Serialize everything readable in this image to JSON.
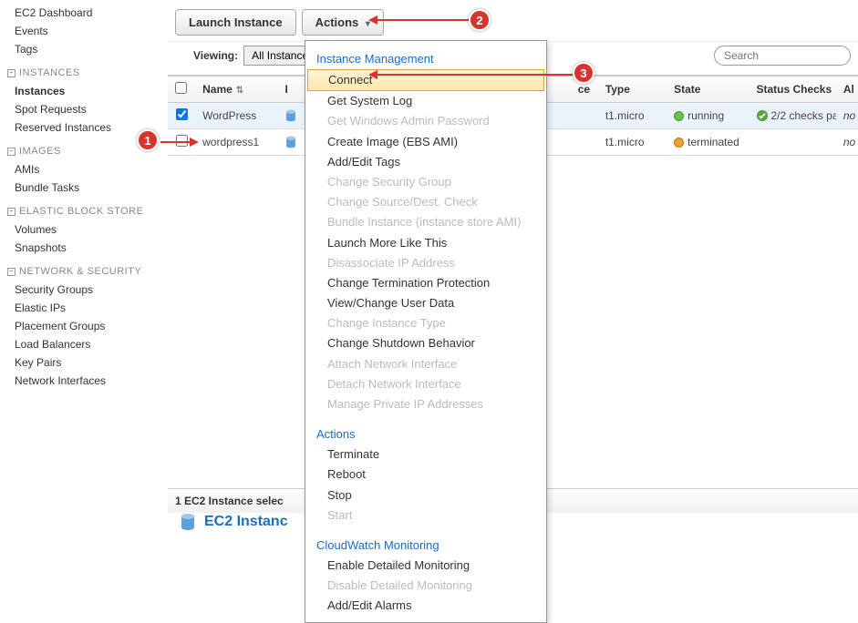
{
  "sidebar": {
    "top": [
      "EC2 Dashboard",
      "Events",
      "Tags"
    ],
    "sections": [
      {
        "title": "INSTANCES",
        "items": [
          "Instances",
          "Spot Requests",
          "Reserved Instances"
        ],
        "bold_index": 0
      },
      {
        "title": "IMAGES",
        "items": [
          "AMIs",
          "Bundle Tasks"
        ]
      },
      {
        "title": "ELASTIC BLOCK STORE",
        "items": [
          "Volumes",
          "Snapshots"
        ]
      },
      {
        "title": "NETWORK & SECURITY",
        "items": [
          "Security Groups",
          "Elastic IPs",
          "Placement Groups",
          "Load Balancers",
          "Key Pairs",
          "Network Interfaces"
        ]
      }
    ]
  },
  "toolbar": {
    "launch": "Launch Instance",
    "actions": "Actions"
  },
  "viewing": {
    "label": "Viewing:",
    "selected": "All Instances",
    "search_placeholder": "Search"
  },
  "columns": {
    "name": "Name",
    "i": "I",
    "ce": "ce",
    "type": "Type",
    "state": "State",
    "status": "Status Checks",
    "al": "Al"
  },
  "rows": [
    {
      "checked": true,
      "name": "WordPress",
      "type": "t1.micro",
      "state": "running",
      "state_color": "green",
      "status": "2/2 checks pa",
      "status_ok": true,
      "al": "no"
    },
    {
      "checked": false,
      "name": "wordpress1",
      "type": "t1.micro",
      "state": "terminated",
      "state_color": "orange",
      "status": "",
      "status_ok": false,
      "al": "no"
    }
  ],
  "footer": {
    "selected_text": "1 EC2 Instance selec",
    "detail_title": "EC2 Instanc"
  },
  "dropdown": {
    "groups": [
      {
        "title": "Instance Management",
        "items": [
          {
            "label": "Connect",
            "enabled": true,
            "highlight": true
          },
          {
            "label": "Get System Log",
            "enabled": true
          },
          {
            "label": "Get Windows Admin Password",
            "enabled": false
          },
          {
            "label": "Create Image (EBS AMI)",
            "enabled": true
          },
          {
            "label": "Add/Edit Tags",
            "enabled": true
          },
          {
            "label": "Change Security Group",
            "enabled": false
          },
          {
            "label": "Change Source/Dest. Check",
            "enabled": false
          },
          {
            "label": "Bundle Instance (instance store AMI)",
            "enabled": false
          },
          {
            "label": "Launch More Like This",
            "enabled": true
          },
          {
            "label": "Disassociate IP Address",
            "enabled": false
          },
          {
            "label": "Change Termination Protection",
            "enabled": true
          },
          {
            "label": "View/Change User Data",
            "enabled": true
          },
          {
            "label": "Change Instance Type",
            "enabled": false
          },
          {
            "label": "Change Shutdown Behavior",
            "enabled": true
          },
          {
            "label": "Attach Network Interface",
            "enabled": false
          },
          {
            "label": "Detach Network Interface",
            "enabled": false
          },
          {
            "label": "Manage Private IP Addresses",
            "enabled": false
          }
        ]
      },
      {
        "title": "Actions",
        "items": [
          {
            "label": "Terminate",
            "enabled": true
          },
          {
            "label": "Reboot",
            "enabled": true
          },
          {
            "label": "Stop",
            "enabled": true
          },
          {
            "label": "Start",
            "enabled": false
          }
        ]
      },
      {
        "title": "CloudWatch Monitoring",
        "items": [
          {
            "label": "Enable Detailed Monitoring",
            "enabled": true
          },
          {
            "label": "Disable Detailed Monitoring",
            "enabled": false
          },
          {
            "label": "Add/Edit Alarms",
            "enabled": true
          }
        ]
      }
    ]
  },
  "callouts": {
    "c1": "1",
    "c2": "2",
    "c3": "3"
  }
}
